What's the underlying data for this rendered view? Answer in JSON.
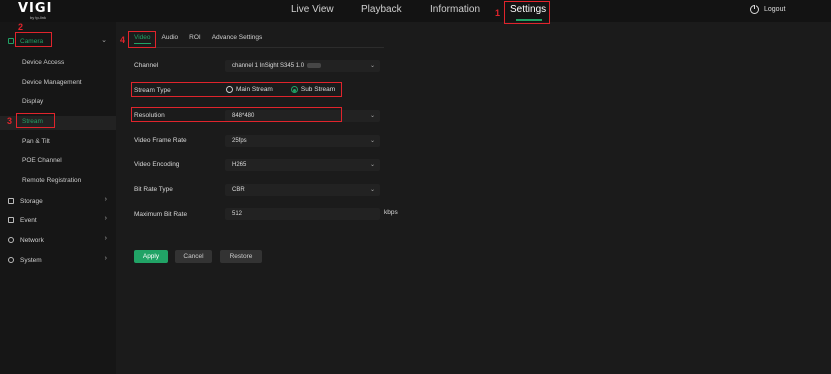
{
  "brand": {
    "logo": "VIGI",
    "sub": "by tp-link"
  },
  "nav": {
    "live_view": "Live View",
    "playback": "Playback",
    "information": "Information",
    "settings": "Settings"
  },
  "logout": "Logout",
  "sidebar": {
    "camera": "Camera",
    "camera_sub": [
      "Device Access",
      "Device Management",
      "Display",
      "Stream",
      "Pan & Tilt",
      "POE Channel",
      "Remote Registration"
    ],
    "storage": "Storage",
    "event": "Event",
    "network": "Network",
    "system": "System"
  },
  "tabs": [
    "Video",
    "Audio",
    "ROI",
    "Advance Settings"
  ],
  "form": {
    "channel_label": "Channel",
    "channel_value": "channel 1 InSight S345 1.0",
    "stream_type_label": "Stream Type",
    "main_stream": "Main Stream",
    "sub_stream": "Sub Stream",
    "resolution_label": "Resolution",
    "resolution_value": "848*480",
    "frame_rate_label": "Video Frame Rate",
    "frame_rate_value": "25fps",
    "encoding_label": "Video Encoding",
    "encoding_value": "H265",
    "bitrate_type_label": "Bit Rate Type",
    "bitrate_type_value": "CBR",
    "max_bitrate_label": "Maximum Bit Rate",
    "max_bitrate_value": "512",
    "max_bitrate_unit": "kbps"
  },
  "buttons": {
    "apply": "Apply",
    "cancel": "Cancel",
    "restore": "Restore"
  },
  "annotations": {
    "n1": "1",
    "n2": "2",
    "n3": "3",
    "n4": "4"
  },
  "colors": {
    "accent": "#21a366",
    "annotation": "#e0242c"
  }
}
